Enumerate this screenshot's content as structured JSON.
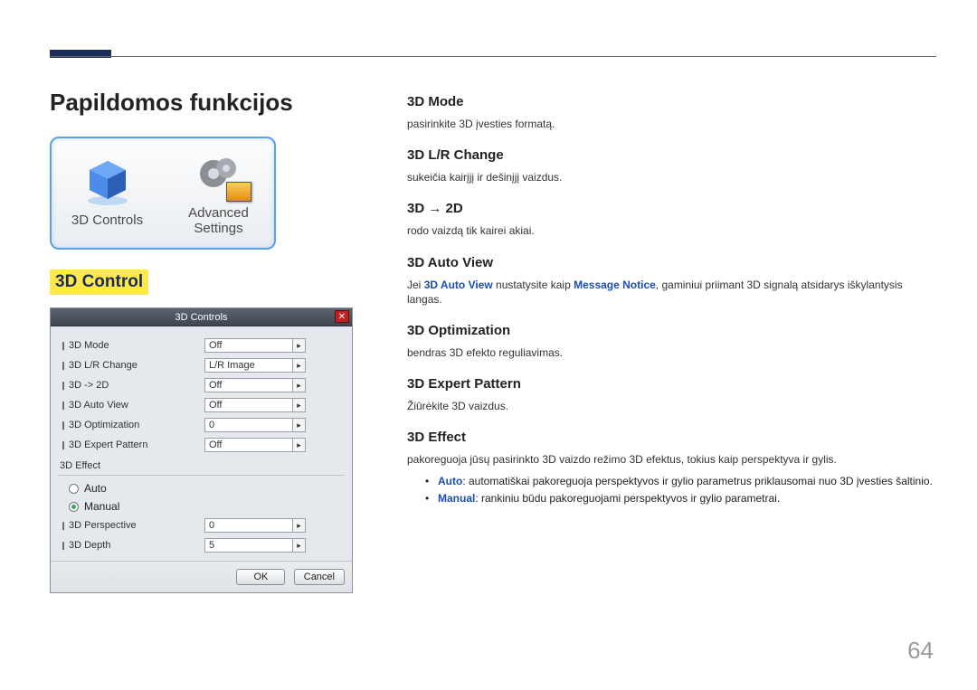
{
  "page_number": "64",
  "title": "Papildomos funkcijos",
  "section_label": "3D Control",
  "icons_card": {
    "left_label": "3D Controls",
    "right_label_line1": "Advanced",
    "right_label_line2": "Settings"
  },
  "dialog": {
    "title": "3D Controls",
    "rows": [
      {
        "label": "3D Mode",
        "value": "Off"
      },
      {
        "label": "3D L/R Change",
        "value": "L/R Image"
      },
      {
        "label": "3D -> 2D",
        "value": "Off"
      },
      {
        "label": "3D Auto View",
        "value": "Off"
      },
      {
        "label": "3D Optimization",
        "value": "0"
      },
      {
        "label": "3D Expert Pattern",
        "value": "Off"
      }
    ],
    "effect_group_label": "3D Effect",
    "radios": [
      {
        "label": "Auto",
        "checked": false
      },
      {
        "label": "Manual",
        "checked": true
      }
    ],
    "effect_rows": [
      {
        "label": "3D Perspective",
        "value": "0"
      },
      {
        "label": "3D Depth",
        "value": "5"
      }
    ],
    "ok": "OK",
    "cancel": "Cancel"
  },
  "right": {
    "mode": {
      "h": "3D Mode",
      "p": "pasirinkite 3D įvesties formatą."
    },
    "lr": {
      "h": "3D L/R Change",
      "p": "sukeičia kairįjį ir dešinįjį vaizdus."
    },
    "to2d": {
      "h": "3D → 2D",
      "p": "rodo vaizdą tik kairei akiai."
    },
    "auto": {
      "h": "3D Auto View",
      "p_pre": "Jei ",
      "p_kw1": "3D Auto View",
      "p_mid": " nustatysite kaip ",
      "p_kw2": "Message Notice",
      "p_post": ", gaminiui priimant 3D signalą atsidarys iškylantysis langas."
    },
    "opt": {
      "h": "3D Optimization",
      "p": "bendras 3D efekto reguliavimas."
    },
    "pat": {
      "h": "3D Expert Pattern",
      "p": "Žiūrėkite 3D vaizdus."
    },
    "eff": {
      "h": "3D Effect",
      "p": "pakoreguoja jūsų pasirinkto 3D vaizdo režimo 3D efektus, tokius kaip perspektyva ir gylis.",
      "auto_kw": "Auto",
      "auto_rest": ": automatiškai pakoreguoja perspektyvos ir gylio parametrus priklausomai nuo 3D įvesties šaltinio.",
      "man_kw": "Manual",
      "man_rest": ": rankiniu būdu pakoreguojami perspektyvos ir gylio parametrai."
    }
  }
}
